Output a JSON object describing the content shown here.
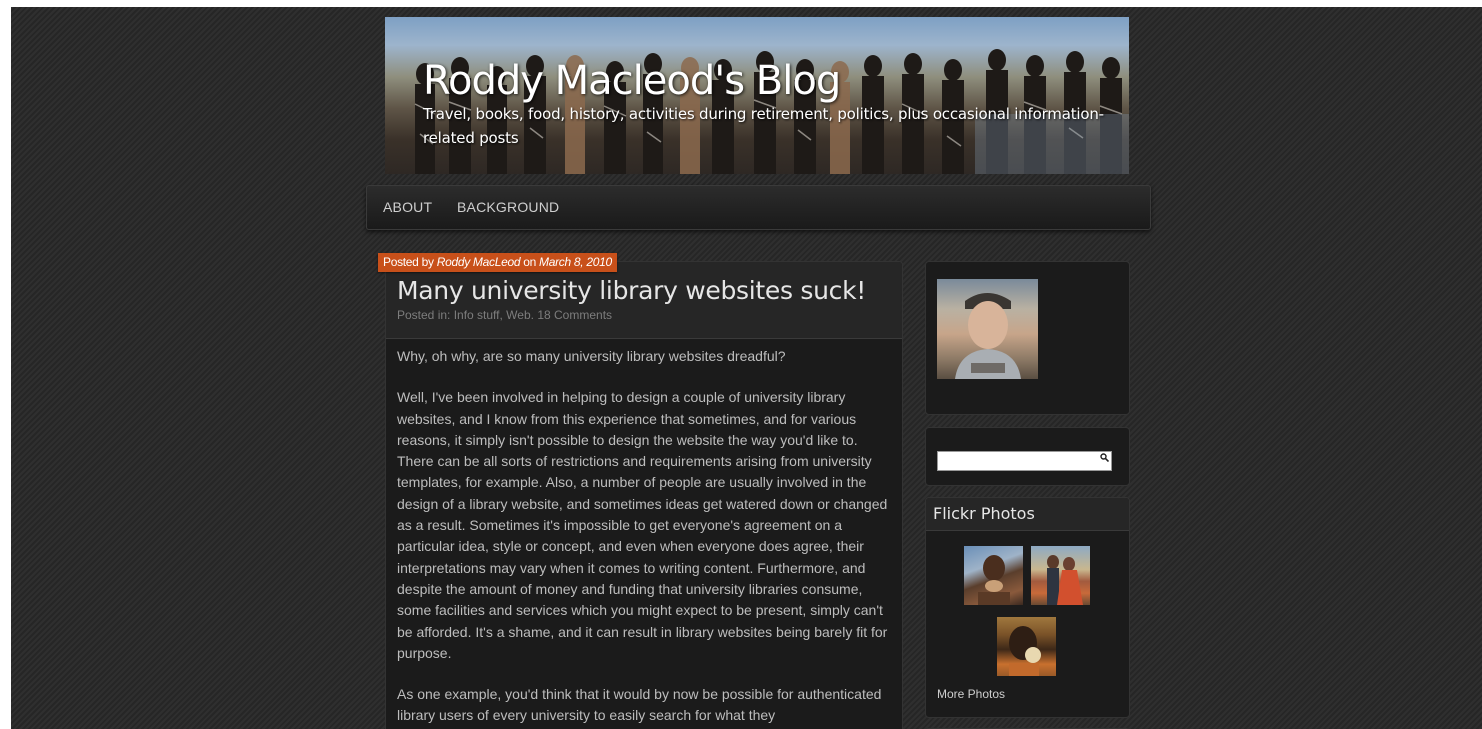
{
  "site": {
    "title": "Roddy Macleod's Blog",
    "description": "Travel, books, food, history, activities during retirement, politics, plus occasional information-related posts"
  },
  "nav": {
    "items": [
      {
        "label": "ABOUT"
      },
      {
        "label": "BACKGROUND"
      }
    ]
  },
  "post": {
    "posted_by_prefix": "Posted by ",
    "author": "Roddy MacLeod",
    "on": " on ",
    "date": "March 8, 2010",
    "title": "Many university library websites suck!",
    "meta_prefix": "Posted in: ",
    "categories": "Info stuff, Web.",
    "comments": "18 Comments",
    "paragraphs": [
      "Why, oh why, are so many university library websites dreadful?",
      "Well, I've been involved in helping to design a couple of university library websites, and I know from this experience that sometimes, and for various reasons, it simply isn't possible to design the website the way you'd like to. There can be all sorts of restrictions and requirements arising from university templates, for example.  Also, a number of people are usually involved in the design of a library website, and sometimes ideas get watered down or changed as a result.  Sometimes it's impossible to get everyone's agreement on a particular idea, style or concept, and even when everyone does agree, their interpretations may vary when it comes to writing content.  Furthermore, and despite the amount of money and funding that university libraries consume, some facilities and services which you might expect to be present, simply can't be afforded.  It's a shame, and it can result in library websites being barely fit for purpose.",
      "As one example, you'd think that it would by now be possible for authenticated library users of every university to easily search for what they"
    ]
  },
  "sidebar": {
    "search": {
      "placeholder": "",
      "value": ""
    },
    "flickr": {
      "title": "Flickr Photos",
      "more_label": "More Photos"
    }
  },
  "colors": {
    "accent": "#c8501a",
    "background": "#2b2b2b",
    "panel": "#1b1b1b"
  },
  "icons": {
    "search": "search-icon"
  }
}
